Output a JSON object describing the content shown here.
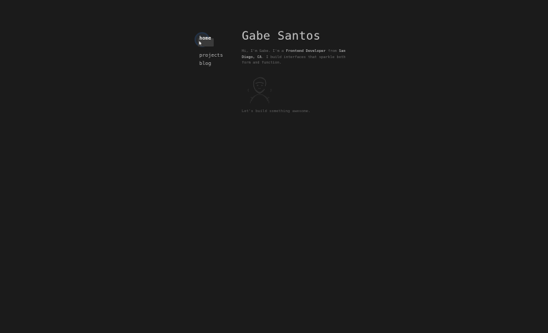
{
  "nav": {
    "items": [
      {
        "label": "home",
        "active": true
      },
      {
        "label": "projects",
        "active": false
      },
      {
        "label": "blog",
        "active": false
      }
    ]
  },
  "hero": {
    "name": "Gabe Santos",
    "bio_prefix": "Hi, I'm Gabe. I'm a ",
    "bio_role": "Frontend Developer",
    "bio_mid": " from ",
    "bio_location": "San Diego, CA",
    "bio_suffix": ". I build interfaces that sparkle both form and function.",
    "cta": "Let's build something awesome."
  },
  "icons": {
    "cursor": "pointer-cursor-icon",
    "avatar": "portrait-illustration"
  },
  "colors": {
    "background": "#1b1b1b",
    "title": "#c8c8c8",
    "text_muted": "#6f6f6f",
    "nav_active_ring": "#223247"
  }
}
